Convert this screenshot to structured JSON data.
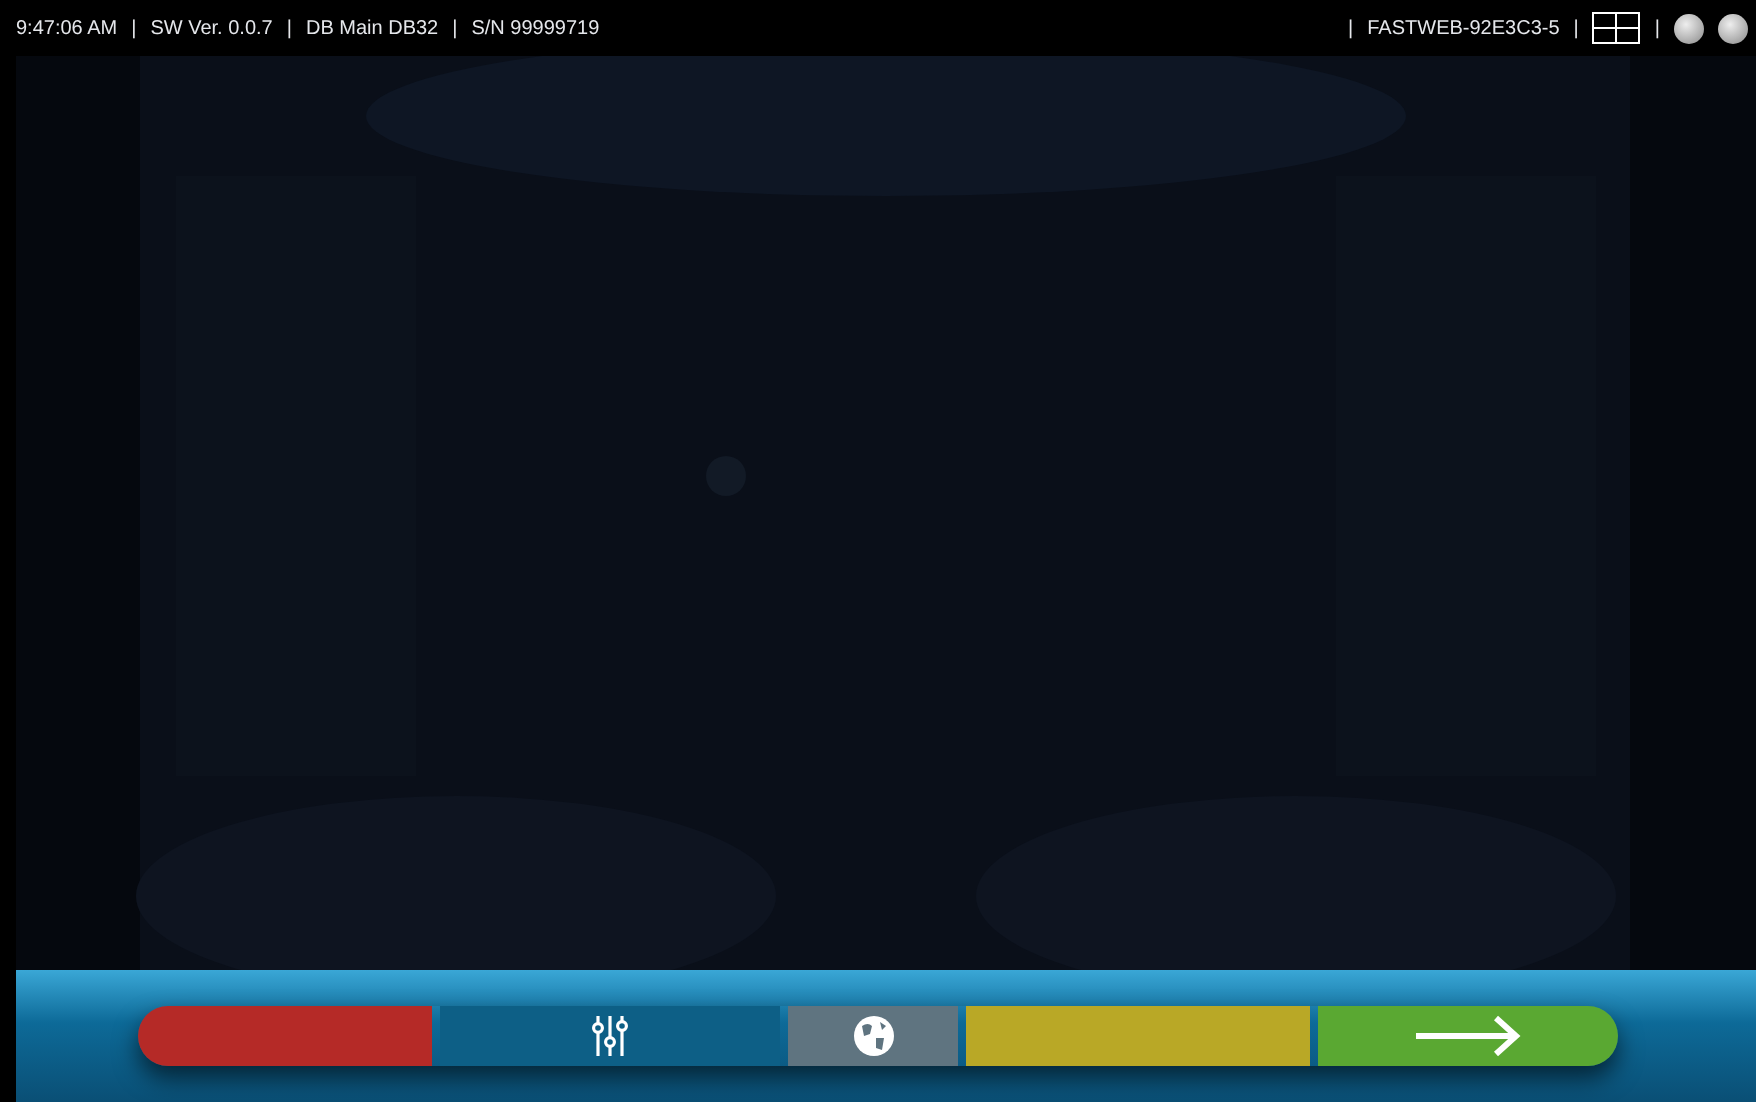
{
  "status_bar": {
    "left": [
      "9:47:06 AM",
      "SW Ver. 0.0.7",
      "DB Main DB32",
      "S/N 99999719"
    ],
    "separator": "|",
    "network": "FASTWEB-92E3C3-5"
  },
  "buttons": [
    {
      "kind": "plain",
      "color": "#b52a27"
    },
    {
      "kind": "sliders",
      "color": "#0d5f86"
    },
    {
      "kind": "globe",
      "color": "#5f7480"
    },
    {
      "kind": "plain",
      "color": "#b9a826"
    },
    {
      "kind": "arrow",
      "color": "#5aa832"
    }
  ]
}
